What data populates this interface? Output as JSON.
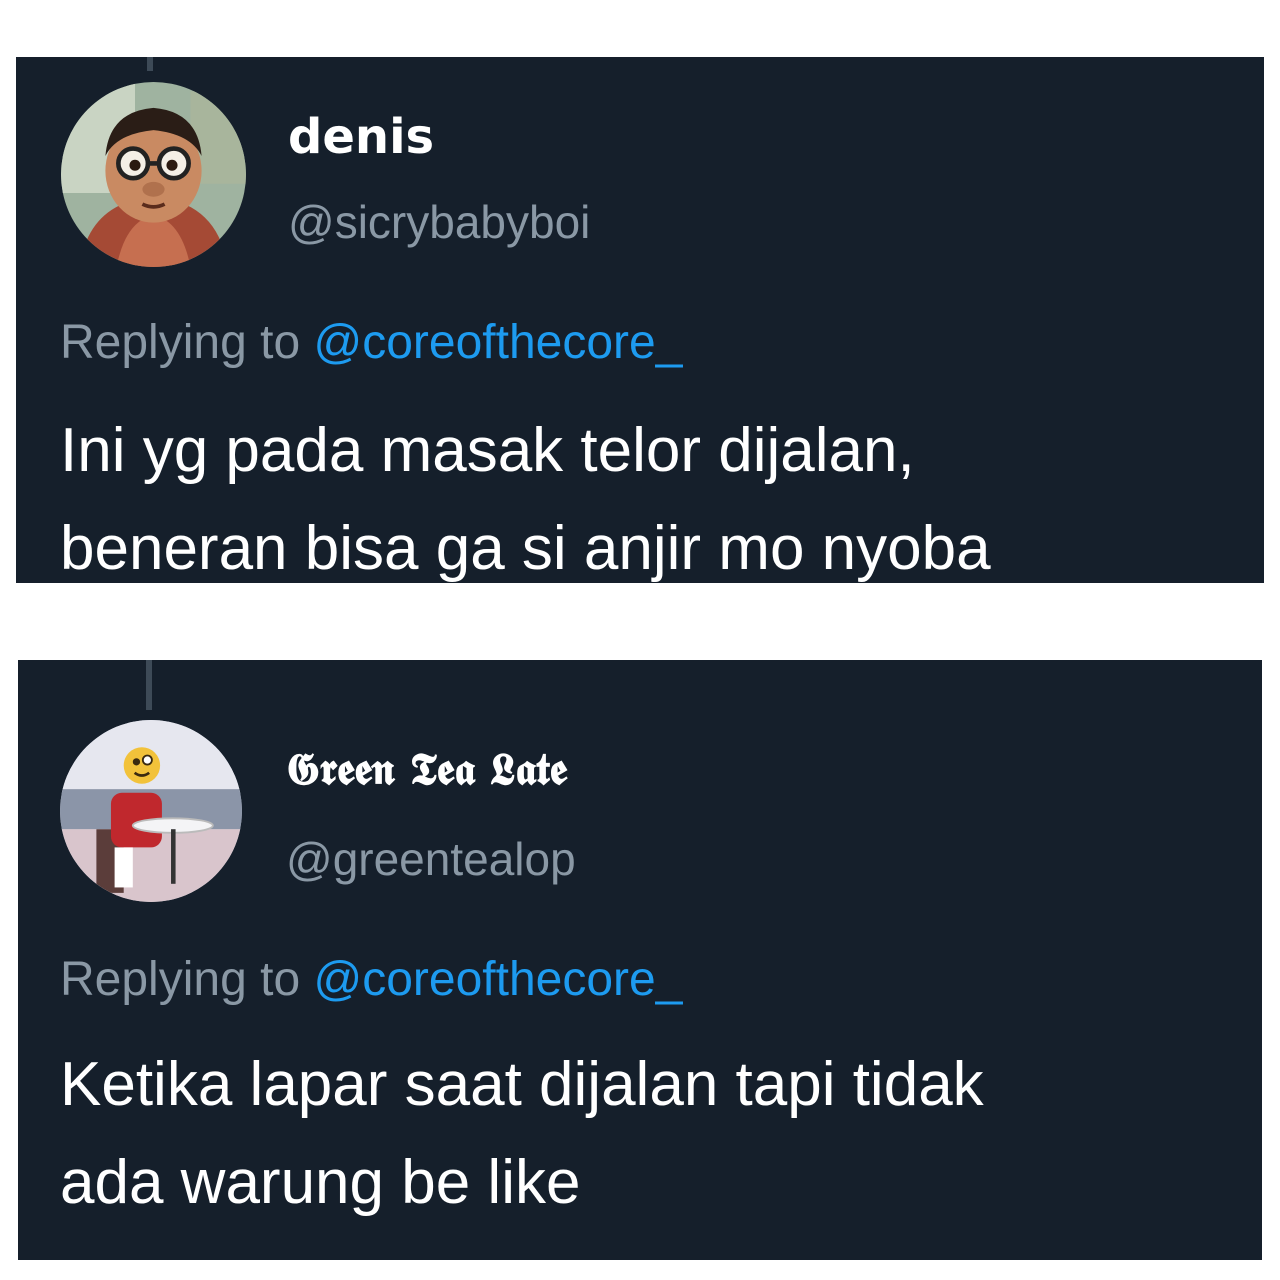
{
  "tweets": [
    {
      "display_name": "denis",
      "handle": "@sicrybabyboi",
      "replying_prefix": "Replying to",
      "replying_handle": "@coreofthecore_",
      "text_lines": [
        "Ini yg pada masak telor dijalan,",
        "beneran bisa ga si anjir mo nyoba"
      ],
      "avatar_icon": "cartoon-boy-glasses-avatar"
    },
    {
      "display_name": "𝕲𝖗𝖊𝖊𝖓 𝕿𝖊𝖆 𝕷𝖆𝖙𝖊",
      "handle": "@greentealop",
      "replying_prefix": "Replying to",
      "replying_handle": "@coreofthecore_",
      "text_lines": [
        "Ketika lapar saat dijalan tapi tidak",
        "ada warung be like"
      ],
      "avatar_icon": "person-emoji-face-avatar"
    }
  ],
  "colors": {
    "background": "#151f2b",
    "text": "#ffffff",
    "muted": "#8a98a5",
    "link": "#1d9bf0"
  }
}
